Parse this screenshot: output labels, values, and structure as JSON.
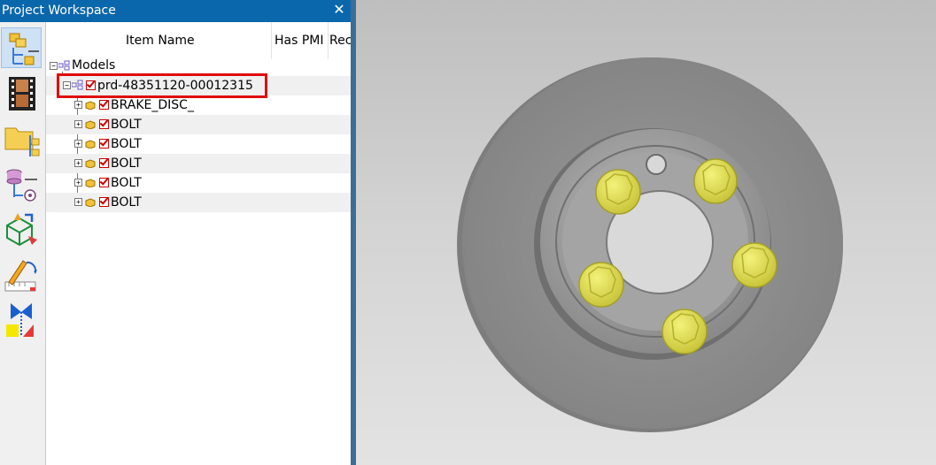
{
  "window": {
    "title": "Project Workspace",
    "close_glyph": "✕"
  },
  "toolbar": {
    "tools": [
      {
        "icon": "assembly-tree-icon"
      },
      {
        "icon": "film-strip-icon"
      },
      {
        "icon": "folder-tree-icon"
      },
      {
        "icon": "database-tree-icon"
      },
      {
        "icon": "3d-box-transform-icon"
      },
      {
        "icon": "edit-measure-icon"
      },
      {
        "icon": "section-cut-icon"
      }
    ]
  },
  "tree": {
    "columns": [
      "Item Name",
      "Has PMI",
      "Rec"
    ],
    "root": {
      "label": "Models",
      "expander": "⊟"
    },
    "product": {
      "label": "prd-48351120-00012315",
      "checked": true,
      "highlighted": true
    },
    "parts": [
      {
        "label": "BRAKE_DISC_",
        "checked": true
      },
      {
        "label": "BOLT",
        "checked": true
      },
      {
        "label": "BOLT",
        "checked": true
      },
      {
        "label": "BOLT",
        "checked": true
      },
      {
        "label": "BOLT",
        "checked": true
      },
      {
        "label": "BOLT",
        "checked": true
      }
    ]
  },
  "colors": {
    "titlebar": "#0b67ac",
    "highlight": "#e00b0b",
    "bolt": "#e6e44a",
    "disc": "#8e8e8e"
  }
}
